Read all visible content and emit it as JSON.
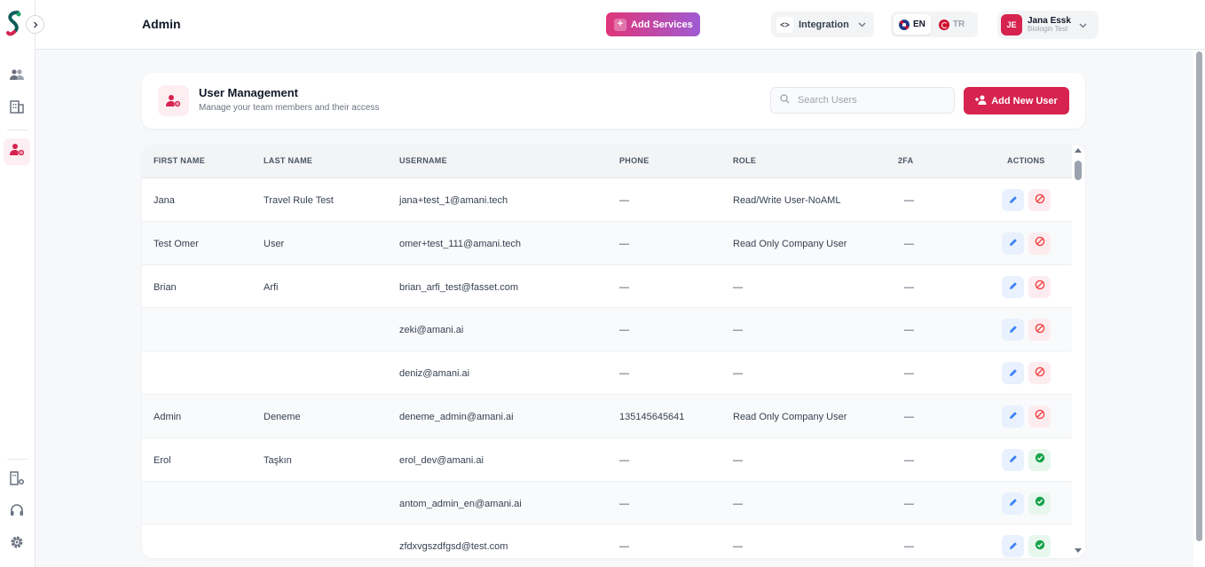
{
  "header": {
    "title": "Admin",
    "add_services_label": "Add Services",
    "integration_label": "Integration",
    "lang_en": "EN",
    "lang_tr": "TR",
    "user_initials": "JE",
    "user_name": "Jana Essk",
    "user_org": "Biologin Test"
  },
  "user_management": {
    "title": "User Management",
    "subtitle": "Manage your team members and their access",
    "search_placeholder": "Search Users",
    "add_new_user_label": "Add New User"
  },
  "table": {
    "columns": {
      "first_name": "FIRST NAME",
      "last_name": "LAST NAME",
      "username": "USERNAME",
      "phone": "PHONE",
      "role": "ROLE",
      "twofa": "2FA",
      "actions": "ACTIONS"
    },
    "rows": [
      {
        "first": "Jana",
        "last": "Travel Rule Test",
        "username": "jana+test_1@amani.tech",
        "phone": "—",
        "role": "Read/Write User-NoAML",
        "twofa": "—",
        "status": "active"
      },
      {
        "first": "Test Omer",
        "last": "User",
        "username": "omer+test_111@amani.tech",
        "phone": "—",
        "role": "Read Only Company User",
        "twofa": "—",
        "status": "active"
      },
      {
        "first": "Brian",
        "last": "Arfi",
        "username": "brian_arfi_test@fasset.com",
        "phone": "—",
        "role": "—",
        "twofa": "—",
        "status": "active"
      },
      {
        "first": "",
        "last": "",
        "username": "zeki@amani.ai",
        "phone": "—",
        "role": "—",
        "twofa": "—",
        "status": "active"
      },
      {
        "first": "",
        "last": "",
        "username": "deniz@amani.ai",
        "phone": "—",
        "role": "—",
        "twofa": "—",
        "status": "active"
      },
      {
        "first": "Admin",
        "last": "Deneme",
        "username": "deneme_admin@amani.ai",
        "phone": "135145645641",
        "role": "Read Only Company User",
        "twofa": "—",
        "status": "active"
      },
      {
        "first": "Erol",
        "last": "Taşkın",
        "username": "erol_dev@amani.ai",
        "phone": "—",
        "role": "—",
        "twofa": "—",
        "status": "inactive"
      },
      {
        "first": "",
        "last": "",
        "username": "antom_admin_en@amani.ai",
        "phone": "—",
        "role": "—",
        "twofa": "—",
        "status": "inactive"
      },
      {
        "first": "",
        "last": "",
        "username": "zfdxvgszdfgsd@test.com",
        "phone": "—",
        "role": "—",
        "twofa": "—",
        "status": "inactive"
      }
    ]
  },
  "colors": {
    "brand": "#d6234f",
    "edit_icon": "#3b82f6",
    "ban_icon": "#ef4444",
    "ok_icon": "#16a34a"
  }
}
